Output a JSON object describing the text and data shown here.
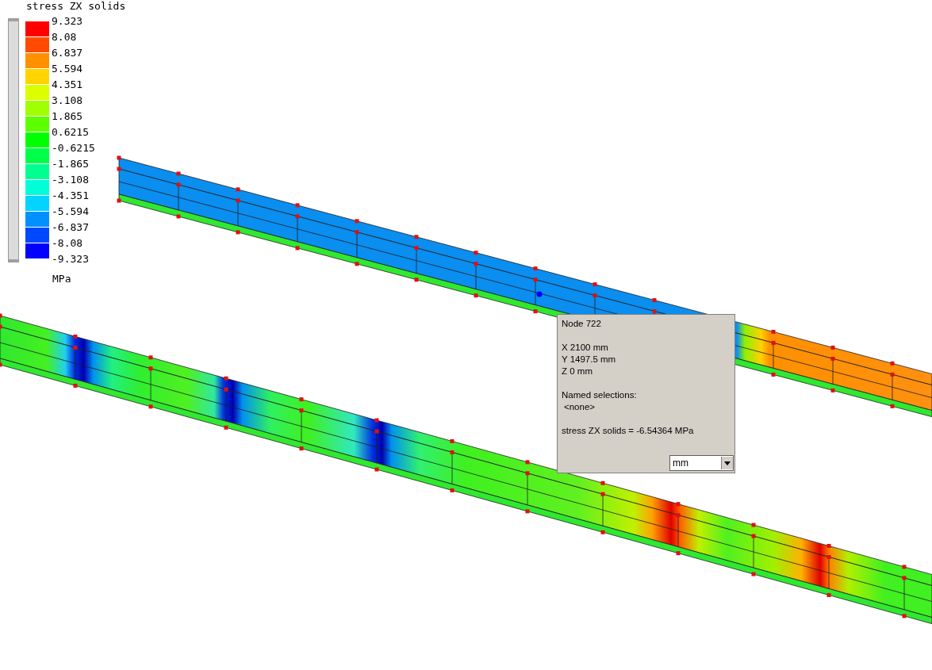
{
  "legend": {
    "title": "stress ZX solids",
    "unit": "MPa",
    "slider": {
      "level": 1
    },
    "ticks": [
      "9.323",
      "8.08",
      "6.837",
      "5.594",
      "4.351",
      "3.108",
      "1.865",
      "0.6215",
      "-0.6215",
      "-1.865",
      "-3.108",
      "-4.351",
      "-5.594",
      "-6.837",
      "-8.08",
      "-9.323"
    ],
    "bands": [
      {
        "color": "#ff0000"
      },
      {
        "color": "#ff4c00"
      },
      {
        "color": "#ff9000"
      },
      {
        "color": "#ffd400"
      },
      {
        "color": "#dcff00"
      },
      {
        "color": "#a0ff00"
      },
      {
        "color": "#5cff00"
      },
      {
        "color": "#00ff00"
      },
      {
        "color": "#00ff48"
      },
      {
        "color": "#00ff90"
      },
      {
        "color": "#00ffd8"
      },
      {
        "color": "#00d4ff"
      },
      {
        "color": "#0090ff"
      },
      {
        "color": "#0048ff"
      },
      {
        "color": "#0000ff"
      }
    ]
  },
  "tooltip": {
    "title": "Node  722",
    "coords": [
      "X  2100 mm",
      "Y  1497.5 mm",
      "Z  0 mm"
    ],
    "selections_label": "Named selections:",
    "selections_value": "<none>",
    "result": "stress ZX solids = -6.54364 MPa",
    "unit_dropdown": {
      "value": "mm"
    }
  }
}
